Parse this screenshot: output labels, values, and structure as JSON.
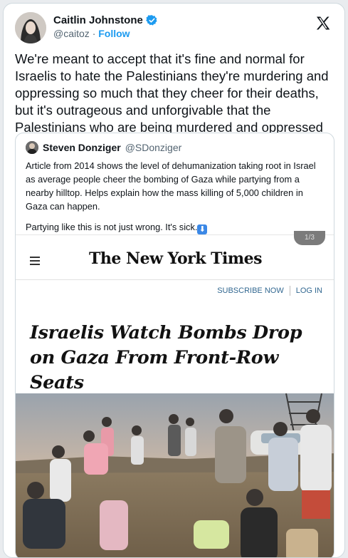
{
  "tweet": {
    "author_name": "Caitlin Johnstone",
    "handle": "@caitoz",
    "separator": "·",
    "follow_label": "Follow",
    "text": "We're meant to accept that it's fine and normal for Israelis to hate the Palestinians they're murdering and oppressing so much that they cheer for their deaths, but it's outrageous and unforgivable that the Palestinians who are being murdered and oppressed hate them back."
  },
  "quote": {
    "author_name": "Steven Donziger",
    "handle": "@SDonziger",
    "paragraph1": "Article from 2014 shows the level of dehumanization taking root in Israel as average people cheer the bombing of Gaza while partying from a nearby hilltop. Helps explain how the mass killing of 5,000 children in Gaza can happen.",
    "paragraph2": "Partying like this is not just wrong. It's sick.",
    "emoji": "⬇"
  },
  "nyt": {
    "badge": "1/3",
    "masthead": "The New York Times",
    "subscribe_label": "SUBSCRIBE NOW",
    "login_label": "LOG IN",
    "headline": "Israelis Watch Bombs Drop on Gaza From Front-Row Seats"
  },
  "colors": {
    "accent": "#1d9bf0",
    "verified": "#1d9bf0",
    "nyt_link": "#326891"
  },
  "icons": {
    "logo": "x-logo-icon",
    "verified": "verified-badge-icon",
    "menu": "hamburger-menu-icon"
  }
}
